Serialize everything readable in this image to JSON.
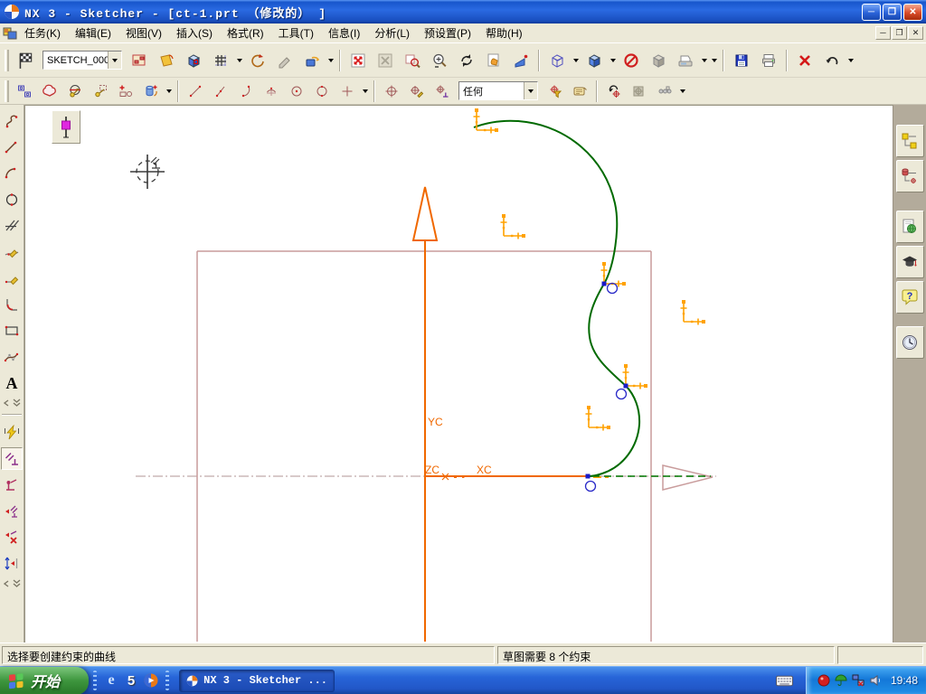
{
  "window": {
    "title": "NX 3 - Sketcher - [ct-1.prt （修改的） ]",
    "minimize_glyph": "─",
    "restore_glyph": "❐",
    "close_glyph": "✕"
  },
  "menu": {
    "items": [
      "任务(K)",
      "编辑(E)",
      "视图(V)",
      "插入(S)",
      "格式(R)",
      "工具(T)",
      "信息(I)",
      "分析(L)",
      "预设置(P)",
      "帮助(H)"
    ]
  },
  "toolbar_top": {
    "sketch_name": "SKETCH_000"
  },
  "toolbar_curve": {
    "snap_filter": "任何"
  },
  "canvas": {
    "yc": "YC",
    "xc": "XC",
    "zc": "ZC"
  },
  "glyphs": {
    "text_tool": "A",
    "help": "?",
    "ie": "e",
    "five": "5"
  },
  "statusbar": {
    "prompt": "选择要创建约束的曲线",
    "hint": "草图需要 8 个约束"
  },
  "taskbar": {
    "start": "开始",
    "task": "NX 3 - Sketcher ...",
    "time": "19:48"
  },
  "icons": {
    "toolbar_top": [
      "finish-sketch-flag",
      "sketch-name-combo",
      "reattach-sketch",
      "orient-view-to-sketch",
      "orient-view-to-model",
      "grid",
      "update-model",
      "edit-disabled",
      "delayed-evaluation",
      "fit-view",
      "fit-selection-disabled",
      "zoom-box",
      "zoom-in-out",
      "rotate-view",
      "pan-view",
      "perspective",
      "wireframe-display",
      "shaded-display",
      "hide-entity",
      "gray-solid-display",
      "snapshot",
      "save",
      "print",
      "delete",
      "undo"
    ],
    "toolbar_curve": [
      "mirror-curve",
      "offset-curve",
      "convert-to-reference",
      "alternate-solution",
      "add-existing-curves",
      "project-curve",
      "sketch-line",
      "sketch-inclined-line",
      "sketch-arc",
      "three-point-arc",
      "circle-center-point",
      "circle",
      "sketch-point",
      "snap-point",
      "snap-end-point",
      "snap-perpendicular",
      "selection-filter",
      "class-selection",
      "snap-undo",
      "snap-disabled",
      "selection-chain"
    ],
    "left_toolbar": [
      "profile",
      "line",
      "arc",
      "circle",
      "derived-lines",
      "quick-trim",
      "quick-extend",
      "fillet",
      "rectangle",
      "studio-spline",
      "text",
      "inferred-dimensions",
      "constraints",
      "alternate-solution",
      "show-constraints",
      "remove-constraints",
      "animate-dimension"
    ],
    "resource_bar": [
      "assembly-navigator",
      "part-navigator",
      "web-browser",
      "roles",
      "help",
      "history-palette"
    ],
    "tray": [
      "input-method-keyboard",
      "antivirus-ball",
      "safety-umbrella",
      "network-offline",
      "volume"
    ]
  }
}
